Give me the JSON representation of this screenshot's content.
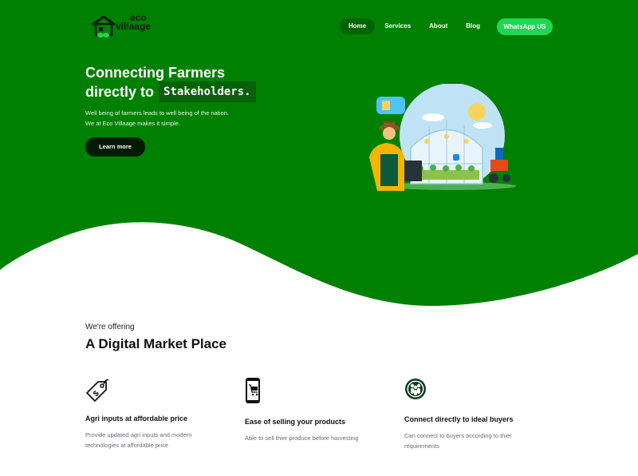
{
  "brand": {
    "name_line1": "eco",
    "name_line2": "villaage",
    "colors": {
      "primary_green": "#008000",
      "dark_green": "#006400",
      "whatsapp_green": "#1fd655",
      "button_dark": "#031a03"
    }
  },
  "nav": {
    "items": [
      {
        "label": "Home",
        "active": true
      },
      {
        "label": "Services",
        "active": false
      },
      {
        "label": "About",
        "active": false
      },
      {
        "label": "Blog",
        "active": false
      }
    ],
    "cta_label": "WhatsApp US"
  },
  "hero": {
    "title_line1": "Connecting Farmers",
    "title_line2": "directly to",
    "highlight": "Stakeholders.",
    "text_line1": "Well being of farmers leads to well being of the nation.",
    "text_line2": "We at Eco Villaage makes it simple.",
    "button_label": "Learn more",
    "illustration": "farmer-greenhouse-illustration"
  },
  "offering": {
    "subtitle": "We're offering",
    "title": "A Digital Market Place",
    "features": [
      {
        "icon": "price-tag-icon",
        "title": "Agri inputs at affordable price",
        "text": "Provide updated agri inputs and modern technologies at affordable price"
      },
      {
        "icon": "mobile-cart-icon",
        "title": "Ease of selling your products",
        "text": "Able to sell thier produce before harvesting"
      },
      {
        "icon": "people-group-icon",
        "title": "Connect directly to ideal buyers",
        "text": "Can connect to buyers according to thier requirements"
      }
    ]
  }
}
